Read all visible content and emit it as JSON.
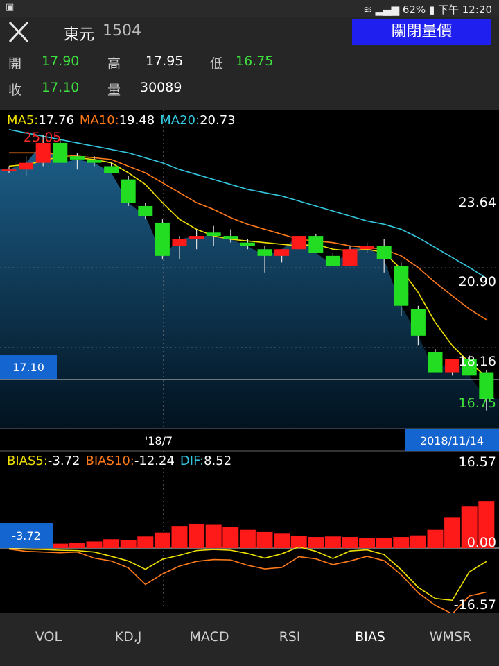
{
  "status": {
    "battery": "62%",
    "time": "下午 12:20"
  },
  "header": {
    "name": "東元",
    "code": "1504",
    "toggle_label": "關閉量價"
  },
  "quote": {
    "open_label": "開",
    "open": "17.90",
    "high_label": "高",
    "high": "17.95",
    "low_label": "低",
    "low": "16.75",
    "close_label": "收",
    "close": "17.10",
    "vol_label": "量",
    "vol": "30089"
  },
  "ma": {
    "ma5_label": "MA5:",
    "ma5": "17.76",
    "ma10_label": "MA10:",
    "ma10": "19.48",
    "ma20_label": "MA20:",
    "ma20": "20.73"
  },
  "price_axis": {
    "top": "23.64",
    "mid": "20.90",
    "low": "18.16",
    "min_label": "16.75",
    "max_label": "25.05",
    "current": "17.10"
  },
  "date_axis": {
    "mid": "'18/7",
    "current": "2018/11/14"
  },
  "bias": {
    "b5_label": "BIAS5:",
    "b5": "-3.72",
    "b10_label": "BIAS10:",
    "b10": "-12.24",
    "dif_label": "DIF:",
    "dif": "8.52",
    "top": "16.57",
    "zero": "0.00",
    "bottom": "-16.57",
    "current": "-3.72"
  },
  "tabs": [
    "VOL",
    "KD,J",
    "MACD",
    "RSI",
    "BIAS",
    "WMSR"
  ],
  "active_tab": "BIAS",
  "colors": {
    "up": "#ff1a1a",
    "down": "#22dd22",
    "ma5": "#f0e000",
    "ma10": "#ff7a1a",
    "ma20": "#35c8e0",
    "accent": "#1f1ff0"
  },
  "chart_data": {
    "type": "candlestick",
    "candles": [
      [
        24.0,
        24.1,
        23.9,
        24.0
      ],
      [
        24.0,
        24.4,
        23.8,
        24.2
      ],
      [
        24.2,
        25.05,
        24.1,
        24.8
      ],
      [
        24.8,
        24.9,
        24.4,
        24.2
      ],
      [
        24.4,
        24.5,
        24.0,
        24.3
      ],
      [
        24.3,
        24.4,
        24.1,
        24.2
      ],
      [
        24.1,
        24.2,
        23.9,
        23.9
      ],
      [
        23.7,
        23.8,
        22.9,
        23.0
      ],
      [
        22.9,
        23.0,
        22.5,
        22.6
      ],
      [
        22.4,
        22.5,
        21.3,
        21.4
      ],
      [
        21.7,
        22.0,
        21.3,
        21.9
      ],
      [
        21.9,
        22.2,
        21.6,
        22.0
      ],
      [
        22.1,
        22.3,
        21.7,
        22.0
      ],
      [
        22.0,
        22.2,
        21.8,
        21.9
      ],
      [
        21.8,
        21.9,
        21.6,
        21.7
      ],
      [
        21.6,
        21.7,
        20.9,
        21.4
      ],
      [
        21.4,
        21.6,
        21.2,
        21.6
      ],
      [
        21.6,
        22.0,
        21.6,
        22.0
      ],
      [
        22.0,
        22.05,
        21.7,
        21.5
      ],
      [
        21.4,
        21.5,
        21.2,
        21.1
      ],
      [
        21.1,
        21.7,
        21.1,
        21.6
      ],
      [
        21.6,
        21.8,
        21.5,
        21.7
      ],
      [
        21.7,
        21.9,
        20.9,
        21.3
      ],
      [
        21.1,
        21.2,
        19.6,
        19.9
      ],
      [
        19.8,
        19.9,
        18.7,
        19.0
      ],
      [
        18.5,
        18.6,
        17.9,
        17.9
      ],
      [
        17.9,
        18.3,
        17.8,
        18.3
      ],
      [
        18.3,
        18.4,
        17.8,
        17.8
      ],
      [
        17.9,
        17.95,
        16.75,
        17.1
      ]
    ],
    "ma5": [
      24.1,
      24.15,
      24.25,
      24.4,
      24.35,
      24.3,
      24.2,
      23.9,
      23.55,
      23.0,
      22.5,
      22.2,
      22.0,
      21.9,
      21.85,
      21.8,
      21.75,
      21.7,
      21.75,
      21.6,
      21.55,
      21.6,
      21.5,
      21.0,
      20.3,
      19.4,
      18.7,
      18.2,
      17.76
    ],
    "ma10": [
      24.5,
      24.5,
      24.5,
      24.45,
      24.4,
      24.35,
      24.3,
      24.1,
      23.9,
      23.6,
      23.3,
      23.0,
      22.8,
      22.55,
      22.35,
      22.2,
      22.05,
      21.9,
      21.85,
      21.8,
      21.7,
      21.65,
      21.6,
      21.4,
      21.05,
      20.6,
      20.2,
      19.8,
      19.48
    ],
    "ma20": [
      25.2,
      25.1,
      25.0,
      24.9,
      24.8,
      24.7,
      24.6,
      24.5,
      24.35,
      24.2,
      24.0,
      23.85,
      23.7,
      23.55,
      23.4,
      23.3,
      23.2,
      23.05,
      22.9,
      22.75,
      22.6,
      22.45,
      22.35,
      22.2,
      21.95,
      21.65,
      21.35,
      21.05,
      20.73
    ],
    "dif": [
      0.9,
      0.2,
      0.6,
      0.8,
      1.0,
      1.2,
      1.6,
      1.5,
      2.1,
      2.8,
      4.0,
      4.4,
      4.2,
      3.8,
      3.3,
      2.9,
      2.6,
      2.2,
      2.0,
      2.1,
      2.0,
      1.8,
      1.8,
      2.0,
      2.3,
      3.3,
      5.6,
      7.5,
      8.52
    ],
    "bias5": [
      -0.2,
      -0.3,
      -0.4,
      -0.6,
      -0.7,
      -1.1,
      -2.3,
      -3.6,
      -5.9,
      -3.1,
      -2.0,
      -0.7,
      -0.4,
      -0.6,
      -1.5,
      -2.8,
      -1.6,
      0.2,
      -0.9,
      -2.9,
      -0.8,
      -0.5,
      -1.8,
      -6.0,
      -10.9,
      -14.0,
      -14.5,
      -6.6,
      -3.72
    ],
    "bias10": [
      -0.3,
      -0.9,
      -1.1,
      -1.3,
      -1.1,
      -2.8,
      -3.6,
      -5.5,
      -10.1,
      -7.2,
      -5.0,
      -3.7,
      -3.2,
      -3.3,
      -4.8,
      -5.8,
      -5.4,
      -2.4,
      -3.0,
      -4.6,
      -3.6,
      -2.3,
      -3.5,
      -7.4,
      -12.4,
      -15.9,
      -18.3,
      -13.3,
      -12.24
    ],
    "price_range": [
      16.2,
      25.8
    ],
    "bias_range": [
      -16.57,
      16.57
    ]
  }
}
